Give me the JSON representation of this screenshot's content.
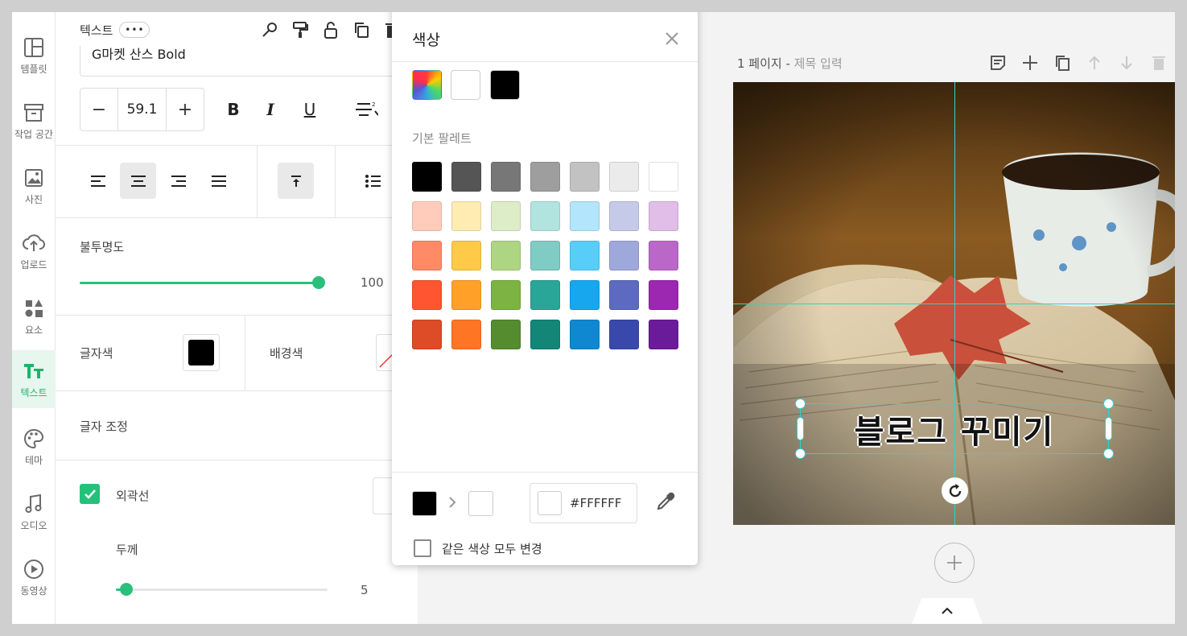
{
  "rail": {
    "items": [
      {
        "label": "템플릿",
        "icon": "layout-icon"
      },
      {
        "label": "작업 공간",
        "icon": "archive-icon"
      },
      {
        "label": "사진",
        "icon": "image-icon"
      },
      {
        "label": "업로드",
        "icon": "cloud-upload-icon"
      },
      {
        "label": "요소",
        "icon": "shapes-icon"
      },
      {
        "label": "텍스트",
        "icon": "text-icon",
        "active": true
      },
      {
        "label": "테마",
        "icon": "palette-icon"
      },
      {
        "label": "오디오",
        "icon": "music-icon"
      },
      {
        "label": "동영상",
        "icon": "play-icon"
      }
    ]
  },
  "panel": {
    "title": "텍스트",
    "more": "•••",
    "font_name": "G마켓 산스 Bold",
    "font_size": "59.1",
    "minus": "−",
    "plus": "+",
    "bold": "B",
    "italic": "I",
    "underline": "U",
    "opacity_label": "불투명도",
    "opacity_value": "100",
    "opacity_level": 1.0,
    "text_color_label": "글자색",
    "text_color": "#000000",
    "bg_color_label": "배경색",
    "adjust_label": "글자 조정",
    "outline_label": "외곽선",
    "outline_checked": true,
    "thickness_label": "두께",
    "thickness_value": "5",
    "thickness_level": 0.05
  },
  "color_popup": {
    "title": "색상",
    "top_swatches": [
      "rainbow",
      "#FFFFFF",
      "#000000"
    ],
    "palette_label": "기본 팔레트",
    "palette": [
      [
        "#000000",
        "#555555",
        "#777777",
        "#9e9e9e",
        "#c2c2c2",
        "#ebebeb",
        "#ffffff"
      ],
      [
        "#ffccbc",
        "#ffecb3",
        "#dcedc8",
        "#b2e4df",
        "#b3e5fc",
        "#c5cae9",
        "#e1bee7"
      ],
      [
        "#ff8a65",
        "#ffca47",
        "#aed581",
        "#80cbc4",
        "#58cdfa",
        "#9fa8da",
        "#ba68c8"
      ],
      [
        "#ff5530",
        "#ffa128",
        "#7cb342",
        "#2aa699",
        "#17a7ee",
        "#5c6bc0",
        "#9c27b0"
      ],
      [
        "#dd4b27",
        "#fe7524",
        "#548c2f",
        "#138678",
        "#0f88d1",
        "#3949ab",
        "#6a1b9a"
      ]
    ],
    "from_color": "#000000",
    "to_color": "#FFFFFF",
    "hex_value": "#FFFFFF",
    "same_color_label": "같은 색상 모두 변경"
  },
  "page": {
    "page_label": "1 페이지 - ",
    "title_placeholder": "제목 입력",
    "headline": "블로그 꾸미기"
  },
  "colors": {
    "accent": "#23c17a",
    "guide": "#2ed3d3"
  }
}
